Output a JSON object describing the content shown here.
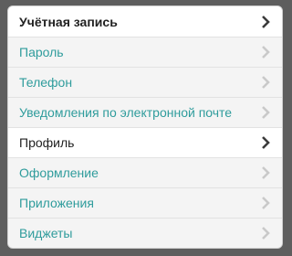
{
  "menu": {
    "items": [
      {
        "label": "Учётная запись",
        "state": "bold-active"
      },
      {
        "label": "Пароль",
        "state": "normal"
      },
      {
        "label": "Телефон",
        "state": "normal"
      },
      {
        "label": "Уведомления по электронной почте",
        "state": "normal"
      },
      {
        "label": "Профиль",
        "state": "active"
      },
      {
        "label": "Оформление",
        "state": "normal"
      },
      {
        "label": "Приложения",
        "state": "normal"
      },
      {
        "label": "Виджеты",
        "state": "normal"
      }
    ],
    "icons": {
      "chevron": "chevron-right-icon"
    },
    "colors": {
      "link": "#2f9c9c",
      "active_text": "#222222",
      "chevron_dim": "#c9c9c9",
      "chevron_dark": "#3b3b3b"
    }
  }
}
